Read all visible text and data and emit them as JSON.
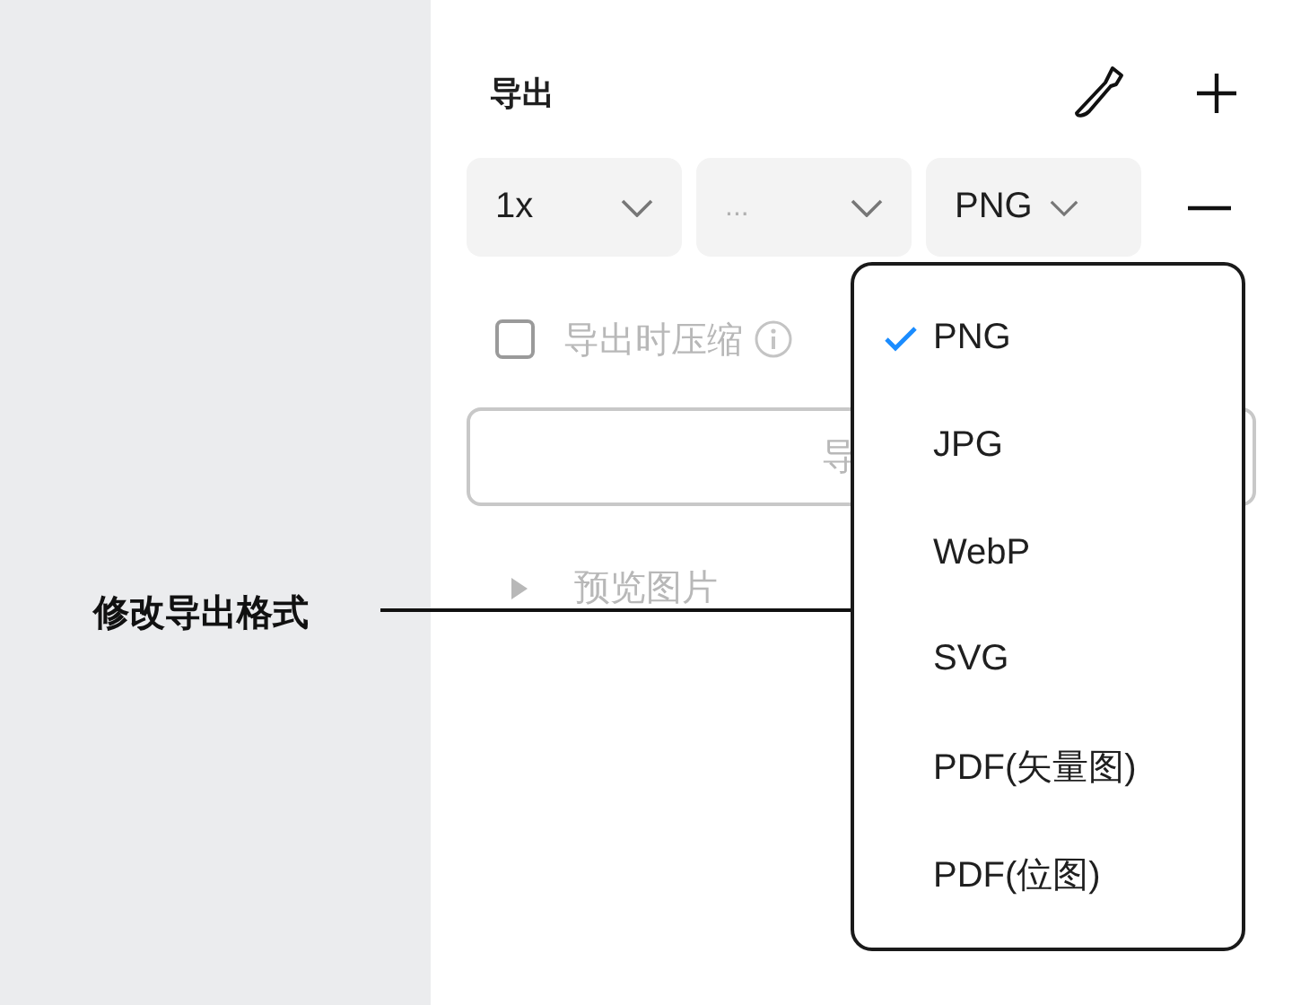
{
  "panel": {
    "title": "导出",
    "selects": [
      {
        "value": "1x"
      },
      {
        "placeholder": "..."
      },
      {
        "value": "PNG"
      }
    ],
    "compress_checkbox": {
      "label": "导出时压缩",
      "checked": false,
      "disabled": true
    },
    "export_button": {
      "label": "导",
      "disabled": true
    },
    "preview": {
      "label": "预览图片",
      "expanded": false
    }
  },
  "format_menu": {
    "items": [
      {
        "label": "PNG",
        "selected": true
      },
      {
        "label": "JPG",
        "selected": false
      },
      {
        "label": "WebP",
        "selected": false
      },
      {
        "label": "SVG",
        "selected": false
      },
      {
        "label": "PDF(矢量图)",
        "selected": false
      },
      {
        "label": "PDF(位图)",
        "selected": false
      }
    ]
  },
  "annotation": {
    "text": "修改导出格式"
  }
}
